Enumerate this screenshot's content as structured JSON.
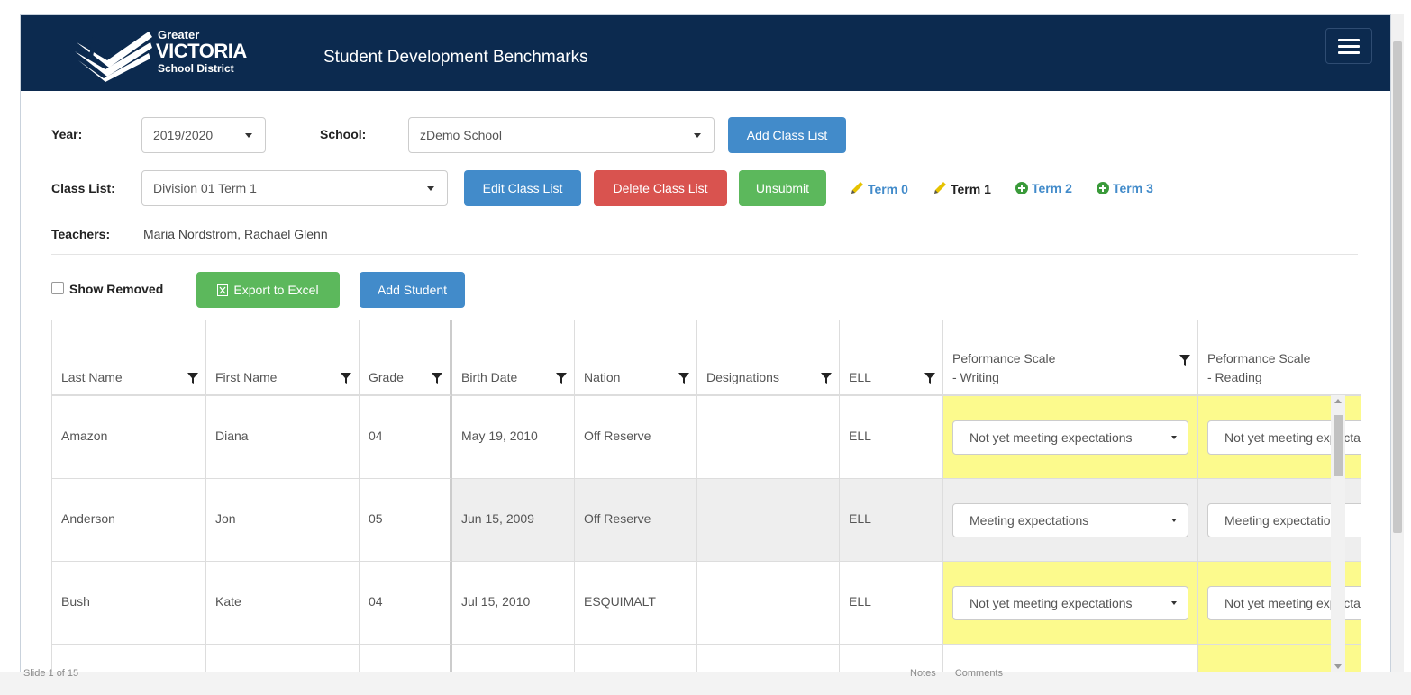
{
  "header": {
    "logo_greater": "Greater",
    "logo_victoria": "VICTORIA",
    "logo_district": "School District",
    "title": "Student Development Benchmarks",
    "color": "#0c2a4f"
  },
  "filters": {
    "year_label": "Year:",
    "year_value": "2019/2020",
    "school_label": "School:",
    "school_value": "zDemo School",
    "add_class_list": "Add Class List",
    "class_list_label": "Class List:",
    "class_list_value": "Division 01 Term 1",
    "edit_class_list": "Edit Class List",
    "delete_class_list": "Delete Class List",
    "unsubmit": "Unsubmit",
    "terms": [
      {
        "label": "Term 0",
        "icon": "pencil-icon"
      },
      {
        "label": "Term 1",
        "icon": "pencil-icon"
      },
      {
        "label": "Term 2",
        "icon": "plus-circle-icon"
      },
      {
        "label": "Term 3",
        "icon": "plus-circle-icon"
      }
    ],
    "teachers_label": "Teachers:",
    "teachers_value": "Maria Nordstrom, Rachael Glenn"
  },
  "toolbar": {
    "show_removed": "Show Removed",
    "export_excel": "Export to Excel",
    "add_student": "Add Student"
  },
  "grid": {
    "columns": {
      "last_name": "Last Name",
      "first_name": "First Name",
      "grade": "Grade",
      "birth_date": "Birth Date",
      "nation": "Nation",
      "designations": "Designations",
      "ell": "ELL",
      "writing_1": "Peformance Scale",
      "writing_2": "- Writing",
      "reading_1": "Peformance Scale",
      "reading_2": "- Reading"
    },
    "rows": [
      {
        "last": "Amazon",
        "first": "Diana",
        "grade": "04",
        "birth": "May 19, 2010",
        "nation": "Off Reserve",
        "designations": "",
        "ell": "ELL",
        "writing": "Not yet meeting expectations",
        "reading": "Not yet meeting expectations"
      },
      {
        "last": "Anderson",
        "first": "Jon",
        "grade": "05",
        "birth": "Jun 15, 2009",
        "nation": "Off Reserve",
        "designations": "",
        "ell": "ELL",
        "writing": "Meeting expectations",
        "reading": "Meeting expectations"
      },
      {
        "last": "Bush",
        "first": "Kate",
        "grade": "04",
        "birth": "Jul 15, 2010",
        "nation": "ESQUIMALT",
        "designations": "",
        "ell": "ELL",
        "writing": "Not yet meeting expectations",
        "reading": "Not yet meeting expectations"
      }
    ]
  },
  "status_bar": {
    "left": "Slide 1 of 15",
    "notes": "Notes",
    "comments": "Comments"
  },
  "colors": {
    "blue": "#428bca",
    "red": "#d9534f",
    "green": "#5cb85c",
    "yellow": "#fcfa8d"
  }
}
